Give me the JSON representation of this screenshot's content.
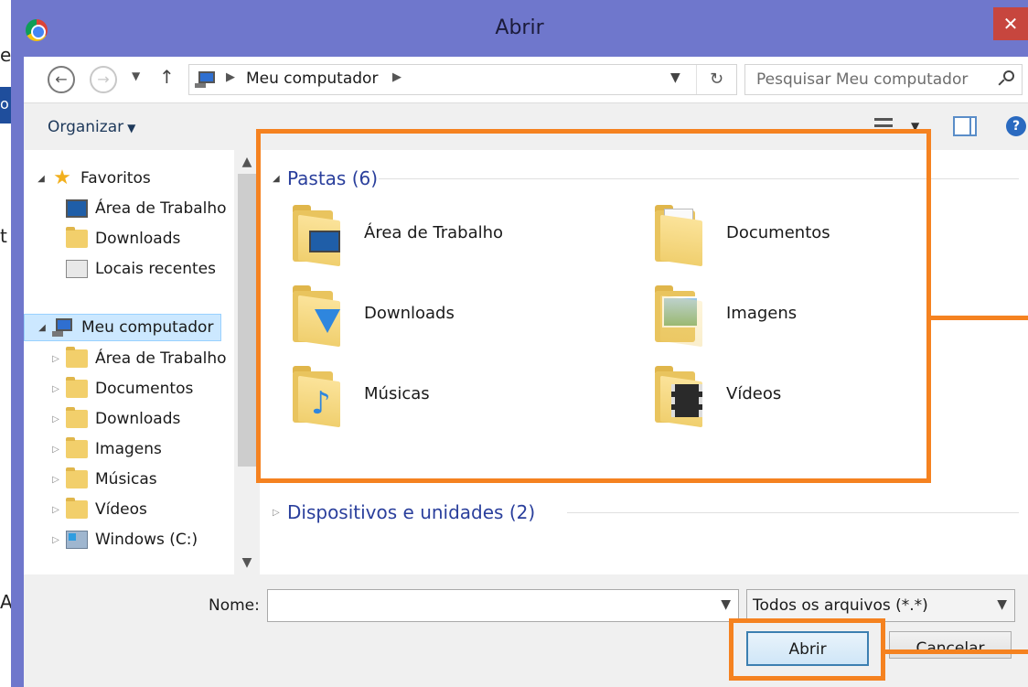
{
  "window": {
    "title": "Abrir",
    "close_label": "✕"
  },
  "background": {
    "chars": [
      "e",
      "o",
      "t",
      "A"
    ]
  },
  "nav": {
    "address": "Meu computador",
    "search_placeholder": "Pesquisar Meu computador"
  },
  "toolbar": {
    "organize_label": "Organizar"
  },
  "sidebar": {
    "favorites": "Favoritos",
    "fav_items": [
      "Área de Trabalho",
      "Downloads",
      "Locais recentes"
    ],
    "computer": "Meu computador",
    "computer_items": [
      "Área de Trabalho",
      "Documentos",
      "Downloads",
      "Imagens",
      "Músicas",
      "Vídeos",
      "Windows (C:)"
    ]
  },
  "content": {
    "folders_group": "Pastas (6)",
    "devices_group": "Dispositivos e unidades (2)",
    "folders": [
      "Área de Trabalho",
      "Documentos",
      "Downloads",
      "Imagens",
      "Músicas",
      "Vídeos"
    ]
  },
  "footer": {
    "name_label": "Nome:",
    "name_value": "",
    "filetype_value": "Todos os arquivos (*.*)",
    "open_button": "Abrir",
    "cancel_button": "Cancelar"
  },
  "colors": {
    "window_frame": "#6f77cc",
    "highlight": "#f58220",
    "group_title": "#2a3f9c",
    "selection": "#cce8ff"
  }
}
